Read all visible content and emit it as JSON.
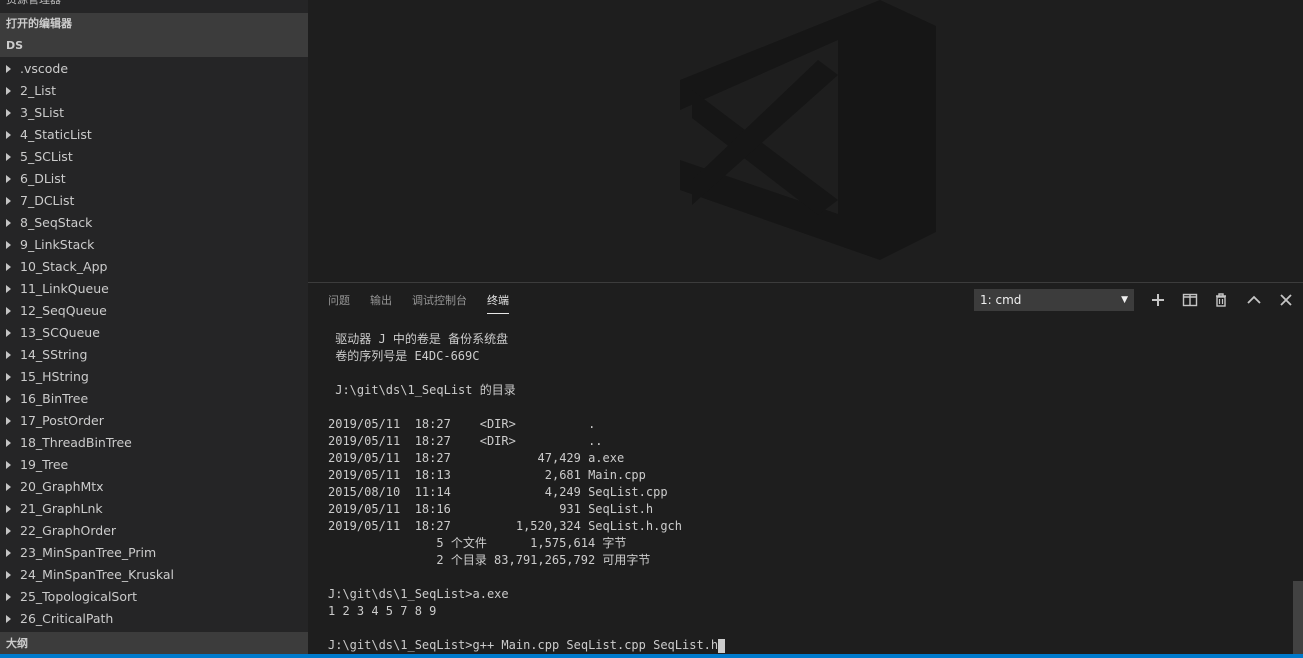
{
  "sidebar": {
    "top_section": "资源管理器",
    "open_editors": "打开的编辑器",
    "folder": "DS",
    "outline": "大纲",
    "items": [
      ".vscode",
      "2_List",
      "3_SList",
      "4_StaticList",
      "5_SCList",
      "6_DList",
      "7_DCList",
      "8_SeqStack",
      "9_LinkStack",
      "10_Stack_App",
      "11_LinkQueue",
      "12_SeqQueue",
      "13_SCQueue",
      "14_SString",
      "15_HString",
      "16_BinTree",
      "17_PostOrder",
      "18_ThreadBinTree",
      "19_Tree",
      "20_GraphMtx",
      "21_GraphLnk",
      "22_GraphOrder",
      "23_MinSpanTree_Prim",
      "24_MinSpanTree_Kruskal",
      "25_TopologicalSort",
      "26_CriticalPath"
    ]
  },
  "panel": {
    "tabs": [
      "问题",
      "输出",
      "调试控制台",
      "终端"
    ],
    "active_tab": "终端",
    "terminal_select": "1: cmd",
    "icons": [
      "plus-icon",
      "split-icon",
      "trash-icon",
      "chevron-up-icon",
      "close-icon"
    ]
  },
  "terminal": {
    "lines": [
      " 驱动器 J 中的卷是 备份系统盘",
      " 卷的序列号是 E4DC-669C",
      "",
      " J:\\git\\ds\\1_SeqList 的目录",
      "",
      "2019/05/11  18:27    <DIR>          .",
      "2019/05/11  18:27    <DIR>          ..",
      "2019/05/11  18:27            47,429 a.exe",
      "2019/05/11  18:13             2,681 Main.cpp",
      "2015/08/10  11:14             4,249 SeqList.cpp",
      "2019/05/11  18:16               931 SeqList.h",
      "2019/05/11  18:27         1,520,324 SeqList.h.gch",
      "               5 个文件      1,575,614 字节",
      "               2 个目录 83,791,265,792 可用字节",
      "",
      "J:\\git\\ds\\1_SeqList>a.exe",
      "1 2 3 4 5 7 8 9",
      ""
    ],
    "prompt_line": "J:\\git\\ds\\1_SeqList>g++ Main.cpp SeqList.cpp SeqList.h"
  },
  "colors": {
    "accent": "#007acc",
    "background": "#1e1e1e",
    "sidebar": "#252526"
  }
}
